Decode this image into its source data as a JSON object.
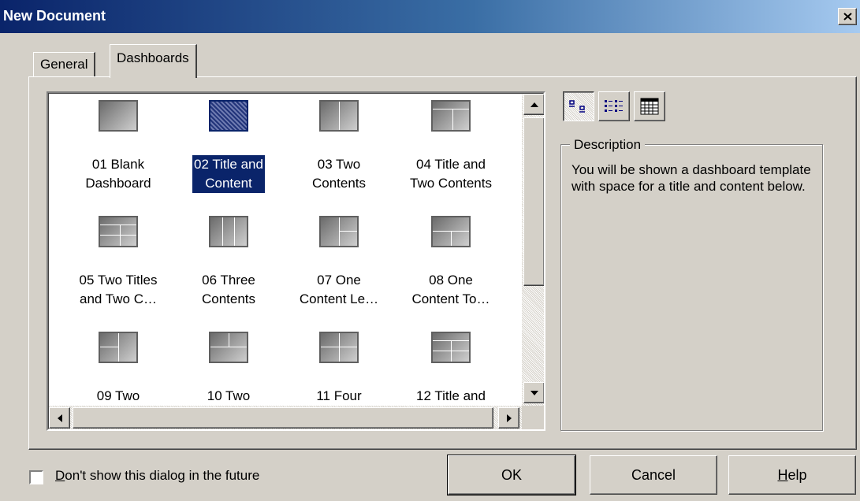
{
  "window": {
    "title": "New Document"
  },
  "tabs": [
    {
      "label": "General",
      "active": false
    },
    {
      "label": "Dashboards",
      "active": true
    }
  ],
  "templates": [
    {
      "line1": "01 Blank",
      "line2": "Dashboard",
      "layout": "blank"
    },
    {
      "line1": "02 Title and",
      "line2": "Content",
      "layout": "blank",
      "selected": true
    },
    {
      "line1": "03 Two",
      "line2": "Contents",
      "layout": "two-col"
    },
    {
      "line1": "04 Title and",
      "line2": "Two Contents",
      "layout": "title-two"
    },
    {
      "line1": "05 Two Titles",
      "line2": "and Two C…",
      "layout": "title-two-alt"
    },
    {
      "line1": "06 Three",
      "line2": "Contents",
      "layout": "three-col"
    },
    {
      "line1": "07 One",
      "line2": "Content Le…",
      "layout": "left-right2"
    },
    {
      "line1": "08 One",
      "line2": "Content To…",
      "layout": "top-bottom2"
    },
    {
      "line1": "09 Two",
      "line2": "",
      "layout": "left2-right"
    },
    {
      "line1": "10 Two",
      "line2": "",
      "layout": "top2-bottom"
    },
    {
      "line1": "11 Four",
      "line2": "",
      "layout": "four"
    },
    {
      "line1": "12 Title and",
      "line2": "",
      "layout": "title-four"
    }
  ],
  "view_buttons": [
    {
      "icon": "large-icons-view-icon",
      "pressed": true
    },
    {
      "icon": "list-view-icon",
      "pressed": false
    },
    {
      "icon": "details-view-icon",
      "pressed": false
    }
  ],
  "description": {
    "legend": "Description",
    "text": "You will be shown a dashboard template with space for a title and content below."
  },
  "footer": {
    "checkbox_label": "Don't show this dialog in the future",
    "checkbox_checked": false,
    "ok_label": "OK",
    "cancel_label": "Cancel",
    "help_label": "Help"
  }
}
